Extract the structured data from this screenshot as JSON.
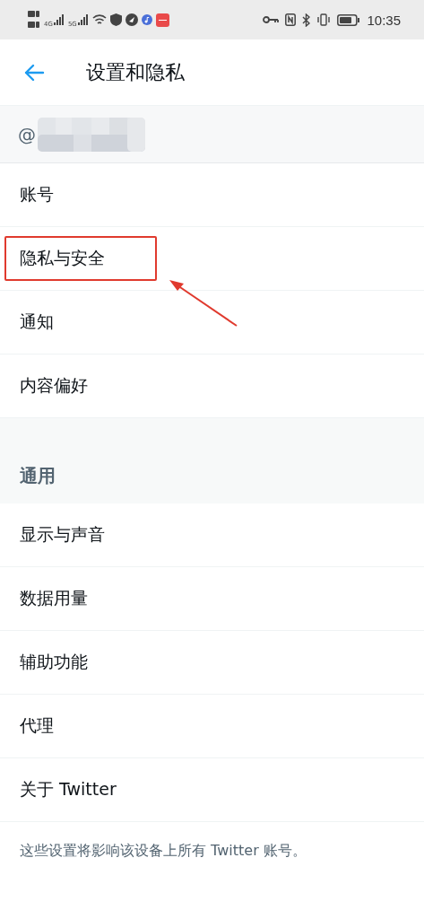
{
  "status_bar": {
    "network_labels": [
      "4G",
      "5G"
    ],
    "time": "10:35"
  },
  "header": {
    "title": "设置和隐私"
  },
  "account": {
    "handle_prefix": "@"
  },
  "groups": [
    {
      "items": [
        {
          "label": "账号",
          "highlighted": false
        },
        {
          "label": "隐私与安全",
          "highlighted": true
        },
        {
          "label": "通知",
          "highlighted": false
        },
        {
          "label": "内容偏好",
          "highlighted": false
        }
      ]
    },
    {
      "heading": "通用",
      "items": [
        {
          "label": "显示与声音",
          "highlighted": false
        },
        {
          "label": "数据用量",
          "highlighted": false
        },
        {
          "label": "辅助功能",
          "highlighted": false
        },
        {
          "label": "代理",
          "highlighted": false
        },
        {
          "label": "关于 Twitter",
          "highlighted": false
        }
      ]
    }
  ],
  "footer": "这些设置将影响该设备上所有 Twitter 账号。"
}
